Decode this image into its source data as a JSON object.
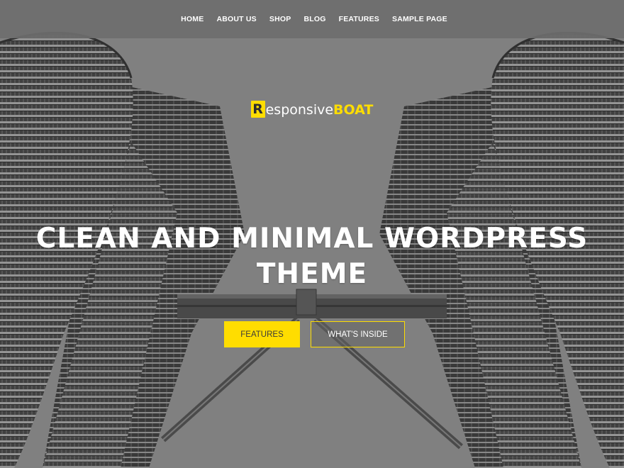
{
  "nav": {
    "items": [
      {
        "label": "HOME"
      },
      {
        "label": "ABOUT US"
      },
      {
        "label": "SHOP"
      },
      {
        "label": "BLOG"
      },
      {
        "label": "FEATURES"
      },
      {
        "label": "SAMPLE PAGE"
      }
    ]
  },
  "logo": {
    "letter": "R",
    "text_light": "esponsive",
    "text_accent": "BOAT"
  },
  "hero": {
    "headline_line1": "CLEAN AND MINIMAL WORDPRESS",
    "headline_line2": "THEME",
    "background_icon": "twin-towers-photo"
  },
  "buttons": {
    "primary_label": "FEATURES",
    "secondary_label": "WHAT'S INSIDE"
  },
  "colors": {
    "accent": "#ffdd00",
    "overlay": "#6e6e6e",
    "text": "#ffffff"
  }
}
